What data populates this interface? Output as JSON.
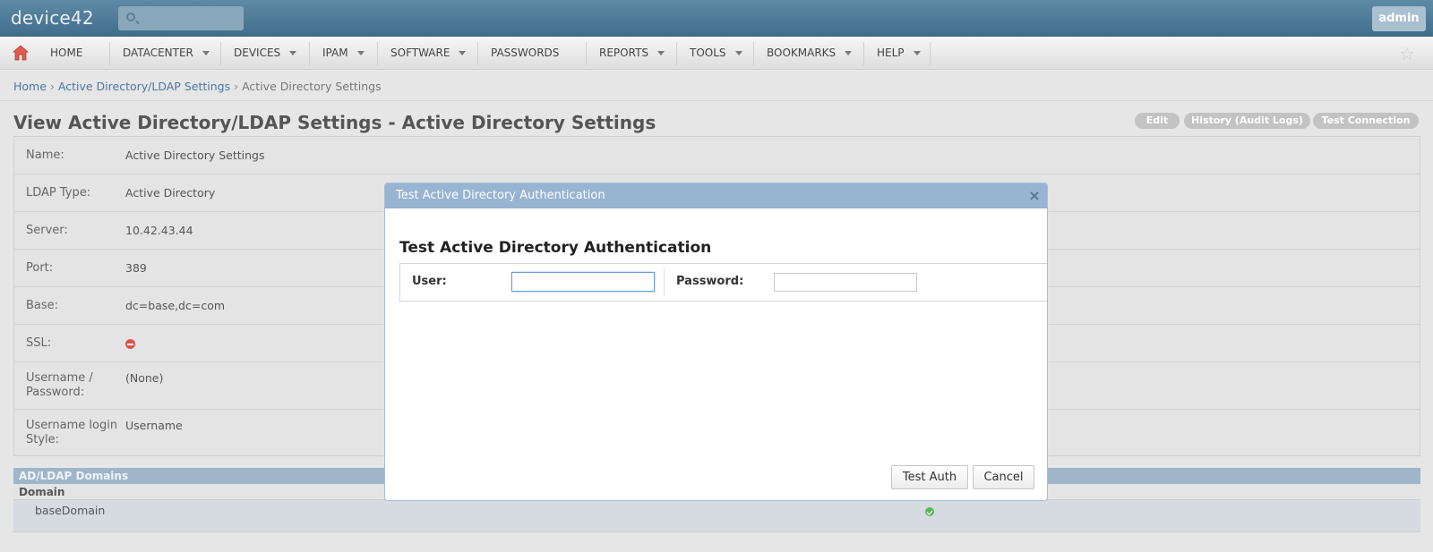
{
  "header": {
    "logo": "device42",
    "search_placeholder": "",
    "user_button": "admin"
  },
  "nav": {
    "items": [
      {
        "label": "HOME",
        "dropdown": false
      },
      {
        "label": "DATACENTER",
        "dropdown": true
      },
      {
        "label": "DEVICES",
        "dropdown": true
      },
      {
        "label": "IPAM",
        "dropdown": true
      },
      {
        "label": "SOFTWARE",
        "dropdown": true
      },
      {
        "label": "PASSWORDS",
        "dropdown": false
      },
      {
        "label": "REPORTS",
        "dropdown": true
      },
      {
        "label": "TOOLS",
        "dropdown": true
      },
      {
        "label": "BOOKMARKS",
        "dropdown": true
      },
      {
        "label": "HELP",
        "dropdown": true
      }
    ]
  },
  "breadcrumb": {
    "home": "Home",
    "section": "Active Directory/LDAP Settings",
    "current": "Active Directory Settings",
    "separator": "›"
  },
  "page": {
    "title": "View Active Directory/LDAP Settings - Active Directory Settings",
    "actions": {
      "edit": "Edit",
      "history": "History (Audit Logs)",
      "test_connection": "Test Connection"
    }
  },
  "details": {
    "name_label": "Name:",
    "name_value": "Active Directory Settings",
    "ldap_type_label": "LDAP Type:",
    "ldap_type_value": "Active Directory",
    "server_label": "Server:",
    "server_value": "10.42.43.44",
    "port_label": "Port:",
    "port_value": "389",
    "base_label": "Base:",
    "base_value": "dc=base,dc=com",
    "ssl_label": "SSL:",
    "username_label_1": "Username /",
    "username_label_2": "Password:",
    "username_value": "(None)",
    "login_style_label_1": "Username login",
    "login_style_label_2": "Style:",
    "login_style_value": "Username"
  },
  "domains": {
    "title": "AD/LDAP Domains",
    "column": "Domain",
    "rows": [
      {
        "name": "baseDomain"
      }
    ]
  },
  "modal": {
    "header": "Test Active Directory Authentication",
    "close": "×",
    "title": "Test Active Directory Authentication",
    "user_label": "User:",
    "user_value": "",
    "password_label": "Password:",
    "password_value": "",
    "test_button": "Test Auth",
    "cancel_button": "Cancel"
  },
  "colors": {
    "topbar": "#4f7d9a",
    "modal_header": "#97b4d2",
    "ssl_off": "#d9534f",
    "check": "#5cb85c"
  }
}
